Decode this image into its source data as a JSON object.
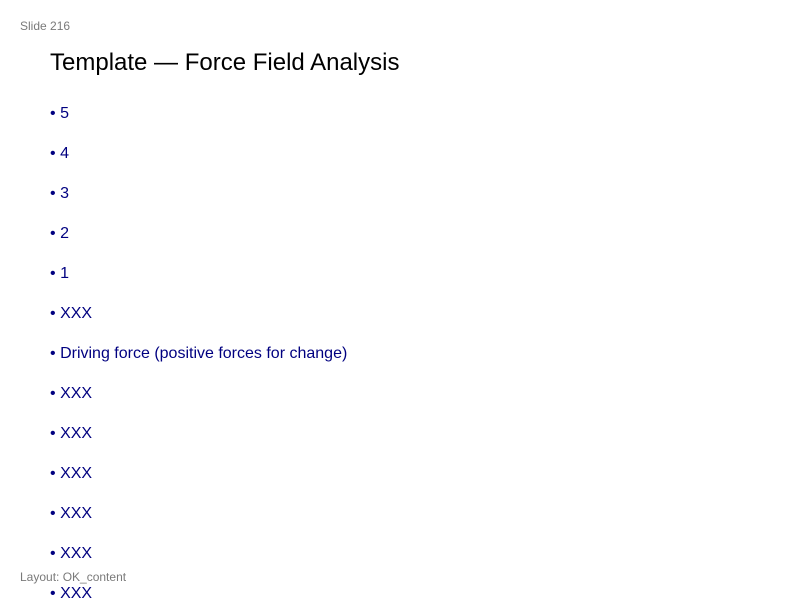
{
  "slide": {
    "number_label": "Slide 216",
    "title": "Template — Force Field Analysis",
    "layout_label": "Layout: OK_content",
    "bullet_symbol": "•",
    "bullets": [
      "5",
      "4",
      "3",
      "2",
      "1",
      "XXX",
      "Driving force (positive forces for change)",
      "XXX",
      "XXX",
      "XXX",
      "XXX",
      "XXX",
      "XXX"
    ]
  },
  "colors": {
    "bullet_text": "#000080",
    "title_text": "#000000",
    "meta_text": "#7a7a7a"
  }
}
